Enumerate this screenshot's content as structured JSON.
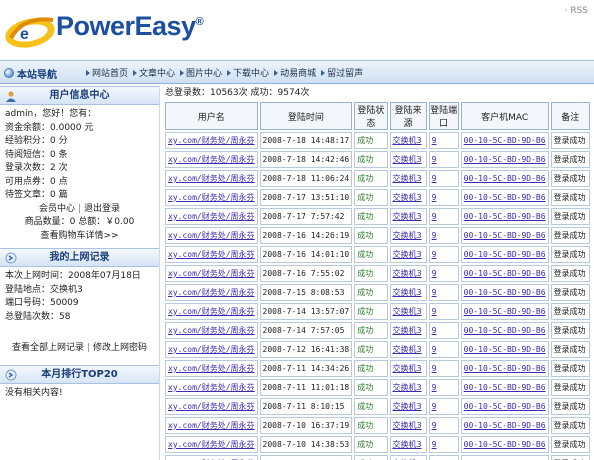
{
  "header": {
    "logo_text": "PowerEasy",
    "logo_reg": "®",
    "rss_label": "· RSS"
  },
  "nav": {
    "title": "本站导航",
    "links": [
      "网站首页",
      "文章中心",
      "图片中心",
      "下载中心",
      "动易商城",
      "留过留声"
    ]
  },
  "user_center": {
    "title": "用户信息中心",
    "greeting": "admin，您好！您有：",
    "lines": [
      "资金余额：0.0000 元",
      "经验积分：0 分",
      "待阅短信：0 条",
      "登录次数：2 次",
      "可用点券：0 点",
      "待签文章：0 篇"
    ],
    "member_center": "会员中心",
    "sep": "|",
    "logout": "退出登录",
    "goods_line": "商品数量：0 总额：￥0.00",
    "cart_link": "查看购物车详情>>"
  },
  "online_record": {
    "title": "我的上网记录",
    "lines": [
      "本次上网时间：2008年07月18日",
      "登陆地点：交换机3",
      "端口号码：50009",
      "总登陆次数：58"
    ],
    "view_all": "查看全部上网记录",
    "sep": "|",
    "change_pwd": "修改上网密码"
  },
  "top20": {
    "title": "本月排行TOP20",
    "content": "没有相关内容!"
  },
  "main": {
    "stats": "总登录数：10563次 成功：9574次",
    "columns": [
      "用户名",
      "登陆时间",
      "登陆状态",
      "登陆来源",
      "登陆端口",
      "客户机MAC",
      "备注"
    ],
    "rows": [
      [
        "xy.com/财务处/周永芬",
        "2008-7-18 14:48:17",
        "成功",
        "交换机3",
        "9",
        "00-10-5C-BD-9D-B6",
        "登录成功"
      ],
      [
        "xy.com/财务处/周永芬",
        "2008-7-18 14:42:46",
        "成功",
        "交换机3",
        "9",
        "00-10-5C-BD-9D-B6",
        "登录成功"
      ],
      [
        "xy.com/财务处/周永芬",
        "2008-7-18 11:06:24",
        "成功",
        "交换机3",
        "9",
        "00-10-5C-BD-9D-B6",
        "登录成功"
      ],
      [
        "xy.com/财务处/周永芬",
        "2008-7-17 13:51:10",
        "成功",
        "交换机3",
        "9",
        "00-10-5C-BD-9D-B6",
        "登录成功"
      ],
      [
        "xy.com/财务处/周永芬",
        "2008-7-17 7:57:42",
        "成功",
        "交换机3",
        "9",
        "00-10-5C-BD-9D-B6",
        "登录成功"
      ],
      [
        "xy.com/财务处/周永芬",
        "2008-7-16 14:26:19",
        "成功",
        "交换机3",
        "9",
        "00-10-5C-BD-9D-B6",
        "登录成功"
      ],
      [
        "xy.com/财务处/周永芬",
        "2008-7-16 14:01:10",
        "成功",
        "交换机3",
        "9",
        "00-10-5C-BD-9D-B6",
        "登录成功"
      ],
      [
        "xy.com/财务处/周永芬",
        "2008-7-16 7:55:02",
        "成功",
        "交换机3",
        "9",
        "00-10-5C-BD-9D-B6",
        "登录成功"
      ],
      [
        "xy.com/财务处/周永芬",
        "2008-7-15 8:08:53",
        "成功",
        "交换机3",
        "9",
        "00-10-5C-BD-9D-B6",
        "登录成功"
      ],
      [
        "xy.com/财务处/周永芬",
        "2008-7-14 13:57:07",
        "成功",
        "交换机3",
        "9",
        "00-10-5C-BD-9D-B6",
        "登录成功"
      ],
      [
        "xy.com/财务处/周永芬",
        "2008-7-14 7:57:05",
        "成功",
        "交换机3",
        "9",
        "00-10-5C-BD-9D-B6",
        "登录成功"
      ],
      [
        "xy.com/财务处/周永芬",
        "2008-7-12 16:41:38",
        "成功",
        "交换机3",
        "9",
        "00-10-5C-BD-9D-B6",
        "登录成功"
      ],
      [
        "xy.com/财务处/周永芬",
        "2008-7-11 14:34:26",
        "成功",
        "交换机3",
        "9",
        "00-10-5C-BD-9D-B6",
        "登录成功"
      ],
      [
        "xy.com/财务处/周永芬",
        "2008-7-11 11:01:18",
        "成功",
        "交换机3",
        "9",
        "00-10-5C-BD-9D-B6",
        "登录成功"
      ],
      [
        "xy.com/财务处/周永芬",
        "2008-7-11 8:10:15",
        "成功",
        "交换机3",
        "9",
        "00-10-5C-BD-9D-B6",
        "登录成功"
      ],
      [
        "xy.com/财务处/周永芬",
        "2008-7-10 16:37:19",
        "成功",
        "交换机3",
        "9",
        "00-10-5C-BD-9D-B6",
        "登录成功"
      ],
      [
        "xy.com/财务处/周永芬",
        "2008-7-10 14:38:53",
        "成功",
        "交换机3",
        "9",
        "00-10-5C-BD-9D-B6",
        "登录成功"
      ],
      [
        "xy.com/财务处/周永芬",
        "2008-7-10 13:58:42",
        "成功",
        "交换机3",
        "9",
        "00-10-5C-BD-9D-B6",
        "登录成功"
      ]
    ]
  },
  "colors": {
    "brand_blue": "#1c4fa0",
    "link_purple": "#3b2bb0",
    "success_green": "#2f7d2f"
  }
}
